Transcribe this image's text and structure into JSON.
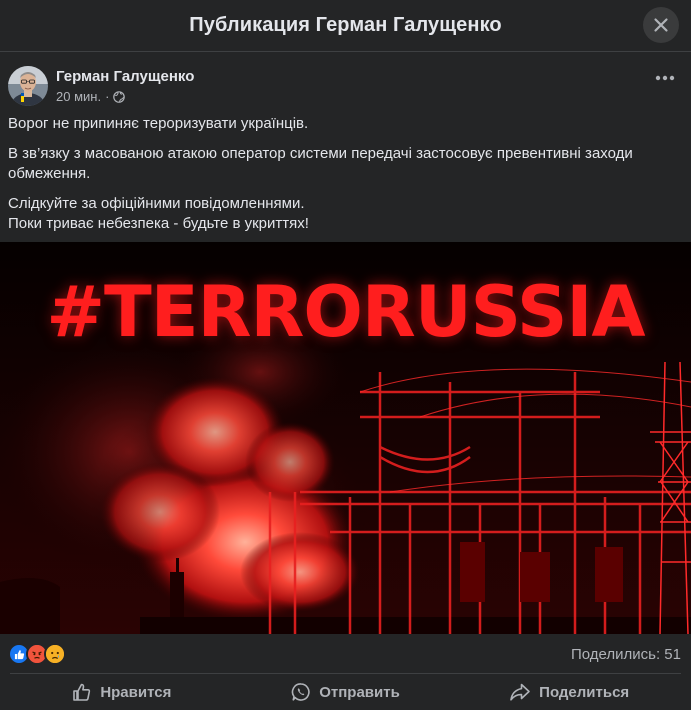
{
  "modal": {
    "title": "Публикация Герман Галущенко",
    "close_icon": "close-icon"
  },
  "post": {
    "author": "Герман Галущенко",
    "time": "20 мин.",
    "privacy_icon": "globe-icon",
    "more_icon": "more-horizontal-icon",
    "paragraphs": [
      "Ворог не припиняє тероризувати українців.",
      "В зв’язку з масованою атакою оператор системи передачі застосовує превентивні заходи обмеження.",
      "Слідкуйте за офіційними повідомленнями.",
      "Поки триває небезпека - будьте в укриттях!"
    ],
    "image": {
      "caption": "#TERRORUSSIA",
      "accent_color": "#ff1e1e"
    }
  },
  "stats": {
    "reactions": [
      "like",
      "angry",
      "sad"
    ],
    "shares": "Поделились: 51"
  },
  "actions": [
    {
      "label": "Нравится",
      "icon": "thumbs-up-icon"
    },
    {
      "label": "Отправить",
      "icon": "whatsapp-icon"
    },
    {
      "label": "Поделиться",
      "icon": "share-icon"
    }
  ],
  "colors": {
    "background": "#242526",
    "text_primary": "#e4e6eb",
    "text_secondary": "#b0b3b8",
    "divider": "#3e4042",
    "like_blue": "#1877f2",
    "angry_red": "#f02849",
    "sad_yellow": "#f7b125"
  }
}
